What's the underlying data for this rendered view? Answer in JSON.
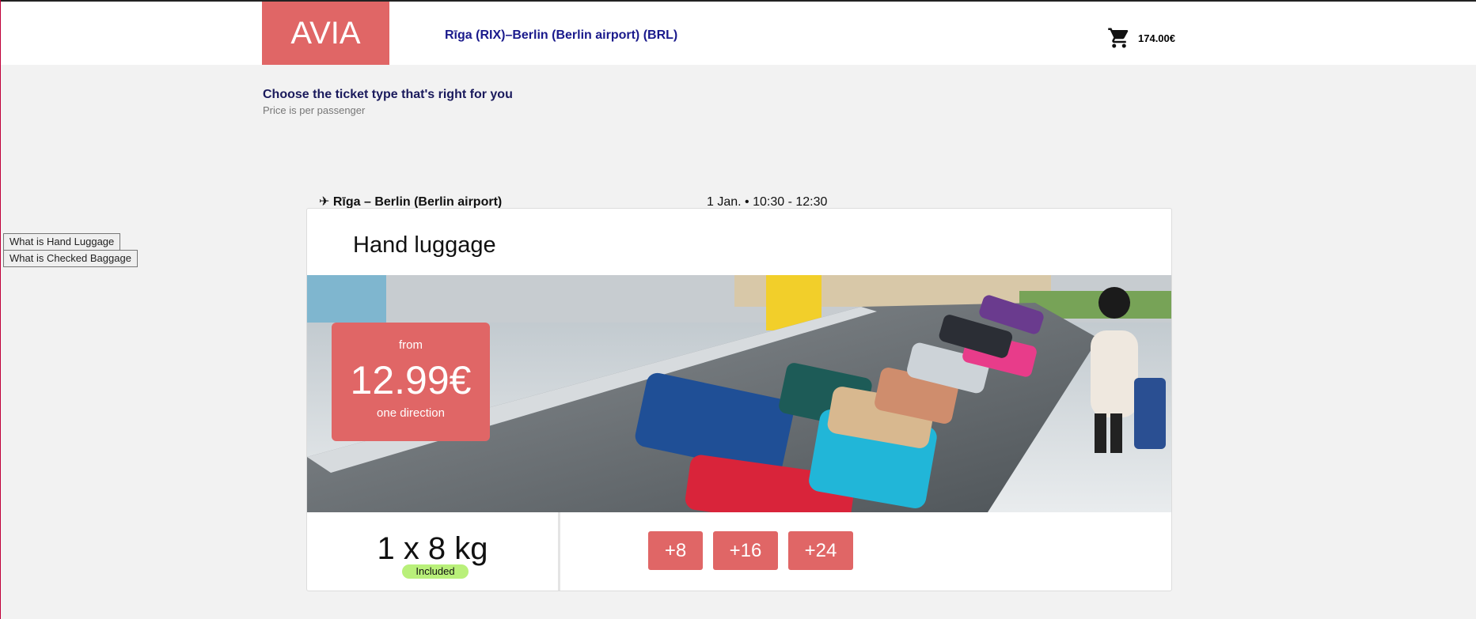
{
  "header": {
    "logo": "AVIA",
    "route": "Rīga (RIX)–Berlin (Berlin airport) (BRL)",
    "cart_total": "174.00€",
    "cart_icon": "cart-icon"
  },
  "intro": {
    "title": "Choose the ticket type that's right for you",
    "subtitle": "Price is per passenger"
  },
  "side_buttons": [
    "What is Hand Luggage",
    "What is Checked Baggage"
  ],
  "flight": {
    "route": "✈ Rīga – Berlin (Berlin airport)",
    "time": "1 Jan. • 10:30 - 12:30"
  },
  "card": {
    "title": "Hand luggage",
    "price": {
      "from": "from",
      "value": "12.99€",
      "direction": "one direction"
    },
    "weight": "1 x 8 kg",
    "badge": "Included",
    "addons": [
      "+8",
      "+16",
      "+24"
    ]
  },
  "colors": {
    "accent": "#e06666",
    "navy": "#1a1a8c",
    "badge_green": "#b9f07a"
  }
}
